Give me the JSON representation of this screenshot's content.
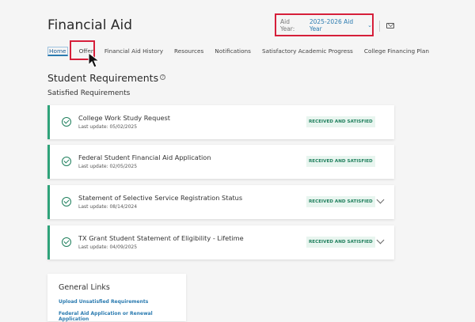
{
  "header": {
    "title": "Financial Aid",
    "aid_year_label": "Aid Year:",
    "aid_year_value": "2025-2026 Aid Year"
  },
  "nav": [
    "Home",
    "Offer",
    "Financial Aid History",
    "Resources",
    "Notifications",
    "Satisfactory Academic Progress",
    "College Financing Plan"
  ],
  "section": {
    "title": "Student Requirements",
    "subtitle": "Satisfied Requirements"
  },
  "requirements": [
    {
      "name": "College Work Study Request",
      "update": "Last update: 05/02/2025",
      "status": "RECEIVED AND SATISFIED",
      "expandable": false
    },
    {
      "name": "Federal Student Financial Aid Application",
      "update": "Last update: 02/05/2025",
      "status": "RECEIVED AND SATISFIED",
      "expandable": false
    },
    {
      "name": "Statement of Selective Service Registration Status",
      "update": "Last update: 08/14/2024",
      "status": "RECEIVED AND SATISFIED",
      "expandable": true
    },
    {
      "name": "TX Grant Student Statement of Eligibility - Lifetime",
      "update": "Last update: 04/09/2025",
      "status": "RECEIVED AND SATISFIED",
      "expandable": true
    }
  ],
  "general_links": {
    "title": "General Links",
    "links": [
      "Upload Unsatisfied Requirements",
      "Federal Aid Application or Renewal Application"
    ]
  },
  "colors": {
    "accent": "#2b7bb0",
    "success": "#1e7f5c",
    "highlight": "#d61f3a"
  }
}
